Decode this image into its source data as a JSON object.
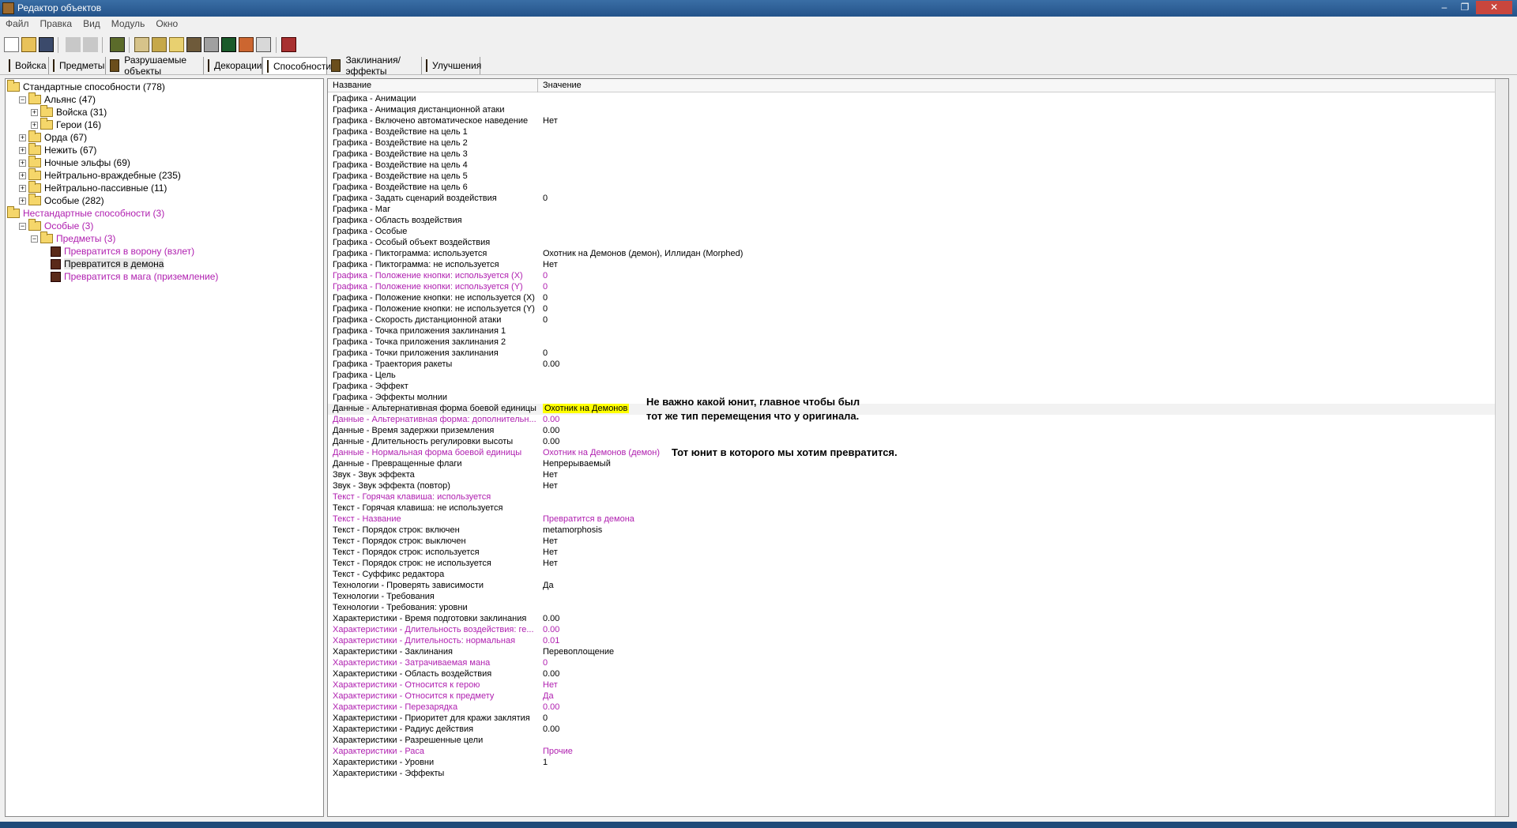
{
  "window": {
    "title": "Редактор объектов",
    "minimize": "–",
    "restore": "❐",
    "close": "✕"
  },
  "menu": [
    "Файл",
    "Правка",
    "Вид",
    "Модуль",
    "Окно"
  ],
  "tabs": [
    {
      "label": "Войска"
    },
    {
      "label": "Предметы"
    },
    {
      "label": "Разрушаемые объекты"
    },
    {
      "label": "Декорации"
    },
    {
      "label": "Способности",
      "active": true
    },
    {
      "label": "Заклинания/эффекты"
    },
    {
      "label": "Улучшения"
    }
  ],
  "tree": [
    {
      "label": "Стандартные способности (778)",
      "level": 0,
      "type": "folder",
      "expander": ""
    },
    {
      "label": "Альянс (47)",
      "level": 1,
      "type": "folder",
      "expander": "−"
    },
    {
      "label": "Войска (31)",
      "level": 2,
      "type": "folder",
      "expander": "+"
    },
    {
      "label": "Герои (16)",
      "level": 2,
      "type": "folder",
      "expander": "+"
    },
    {
      "label": "Орда (67)",
      "level": 1,
      "type": "folder",
      "expander": "+"
    },
    {
      "label": "Нежить (67)",
      "level": 1,
      "type": "folder",
      "expander": "+"
    },
    {
      "label": "Ночные эльфы (69)",
      "level": 1,
      "type": "folder",
      "expander": "+"
    },
    {
      "label": "Нейтрально-враждебные (235)",
      "level": 1,
      "type": "folder",
      "expander": "+"
    },
    {
      "label": "Нейтрально-пассивные (11)",
      "level": 1,
      "type": "folder",
      "expander": "+"
    },
    {
      "label": "Особые (282)",
      "level": 1,
      "type": "folder",
      "expander": "+"
    },
    {
      "label": "Нестандартные способности (3)",
      "level": 0,
      "type": "folder",
      "expander": "",
      "mod": true
    },
    {
      "label": "Особые (3)",
      "level": 1,
      "type": "folder",
      "expander": "−",
      "mod": true
    },
    {
      "label": "Предметы (3)",
      "level": 2,
      "type": "folder",
      "expander": "−",
      "mod": true
    },
    {
      "label": "Превратится в ворону (взлет)",
      "level": 3,
      "type": "ability",
      "mod": true
    },
    {
      "label": "Превратится в демона",
      "level": 3,
      "type": "ability",
      "selected": true
    },
    {
      "label": "Превратится в мага (приземление)",
      "level": 3,
      "type": "ability",
      "mod": true
    }
  ],
  "table": {
    "col_name": "Название",
    "col_value": "Значение",
    "rows": [
      {
        "name": "Графика - Анимации",
        "value": ""
      },
      {
        "name": "Графика - Анимация дистанционной атаки",
        "value": ""
      },
      {
        "name": "Графика - Включено автоматическое наведение",
        "value": "Нет"
      },
      {
        "name": "Графика - Воздействие на цель 1",
        "value": ""
      },
      {
        "name": "Графика - Воздействие на цель 2",
        "value": ""
      },
      {
        "name": "Графика - Воздействие на цель 3",
        "value": ""
      },
      {
        "name": "Графика - Воздействие на цель 4",
        "value": ""
      },
      {
        "name": "Графика - Воздействие на цель 5",
        "value": ""
      },
      {
        "name": "Графика - Воздействие на цель 6",
        "value": ""
      },
      {
        "name": "Графика - Задать сценарий воздействия",
        "value": "0"
      },
      {
        "name": "Графика - Маг",
        "value": ""
      },
      {
        "name": "Графика - Область воздействия",
        "value": ""
      },
      {
        "name": "Графика - Особые",
        "value": ""
      },
      {
        "name": "Графика - Особый объект воздействия",
        "value": ""
      },
      {
        "name": "Графика - Пиктограмма: используется",
        "value": "Охотник на Демонов  (демон), Иллидан (Morphed)"
      },
      {
        "name": "Графика - Пиктограмма: не используется",
        "value": "Нет"
      },
      {
        "name": "Графика - Положение кнопки: используется (X)",
        "value": "0",
        "mod": true
      },
      {
        "name": "Графика - Положение кнопки: используется (Y)",
        "value": "0",
        "mod": true
      },
      {
        "name": "Графика - Положение кнопки: не используется (X)",
        "value": "0"
      },
      {
        "name": "Графика - Положение кнопки: не используется (Y)",
        "value": "0"
      },
      {
        "name": "Графика - Скорость дистанционной атаки",
        "value": "0"
      },
      {
        "name": "Графика - Точка приложения заклинания 1",
        "value": ""
      },
      {
        "name": "Графика - Точка приложения заклинания 2",
        "value": ""
      },
      {
        "name": "Графика - Точки приложения заклинания",
        "value": "0"
      },
      {
        "name": "Графика - Траектория ракеты",
        "value": "0.00"
      },
      {
        "name": "Графика - Цель",
        "value": ""
      },
      {
        "name": "Графика - Эффект",
        "value": ""
      },
      {
        "name": "Графика - Эффекты молнии",
        "value": ""
      },
      {
        "name": "Данные - Альтернативная форма боевой единицы",
        "value": "Охотник на Демонов",
        "highlight": true
      },
      {
        "name": "Данные - Альтернативная форма: дополнительн...",
        "value": "0.00",
        "mod": true
      },
      {
        "name": "Данные - Время задержки приземления",
        "value": "0.00"
      },
      {
        "name": "Данные - Длительность регулировки высоты",
        "value": "0.00"
      },
      {
        "name": "Данные - Нормальная форма боевой единицы",
        "value": "Охотник на Демонов  (демон)",
        "mod": true
      },
      {
        "name": "Данные - Превращенные флаги",
        "value": "Непрерываемый"
      },
      {
        "name": "Звук - Звук эффекта",
        "value": "Нет"
      },
      {
        "name": "Звук - Звук эффекта (повтор)",
        "value": "Нет"
      },
      {
        "name": "Текст - Горячая клавиша: используется",
        "value": "",
        "mod": true
      },
      {
        "name": "Текст - Горячая клавиша: не используется",
        "value": ""
      },
      {
        "name": "Текст - Название",
        "value": "Превратится в демона",
        "mod": true
      },
      {
        "name": "Текст - Порядок строк: включен",
        "value": "metamorphosis"
      },
      {
        "name": "Текст - Порядок строк: выключен",
        "value": "Нет"
      },
      {
        "name": "Текст - Порядок строк: используется",
        "value": "Нет"
      },
      {
        "name": "Текст - Порядок строк: не используется",
        "value": "Нет"
      },
      {
        "name": "Текст - Суффикс редактора",
        "value": ""
      },
      {
        "name": "Технологии - Проверять зависимости",
        "value": "Да"
      },
      {
        "name": "Технологии - Требования",
        "value": ""
      },
      {
        "name": "Технологии - Требования: уровни",
        "value": ""
      },
      {
        "name": "Характеристики - Время подготовки заклинания",
        "value": "0.00"
      },
      {
        "name": "Характеристики - Длительность воздействия: ге...",
        "value": "0.00",
        "mod": true
      },
      {
        "name": "Характеристики - Длительность: нормальная",
        "value": "0.01",
        "mod": true
      },
      {
        "name": "Характеристики - Заклинания",
        "value": "Перевоплощение"
      },
      {
        "name": "Характеристики - Затрачиваемая мана",
        "value": "0",
        "mod": true
      },
      {
        "name": "Характеристики - Область воздействия",
        "value": "0.00"
      },
      {
        "name": "Характеристики - Относится к герою",
        "value": "Нет",
        "mod": true
      },
      {
        "name": "Характеристики - Относится к предмету",
        "value": "Да",
        "mod": true
      },
      {
        "name": "Характеристики - Перезарядка",
        "value": "0.00",
        "mod": true
      },
      {
        "name": "Характеристики - Приоритет для кражи заклятия",
        "value": "0"
      },
      {
        "name": "Характеристики - Радиус действия",
        "value": "0.00"
      },
      {
        "name": "Характеристики - Разрешенные цели",
        "value": ""
      },
      {
        "name": "Характеристики - Раса",
        "value": "Прочие",
        "mod": true
      },
      {
        "name": "Характеристики - Уровни",
        "value": "1"
      },
      {
        "name": "Характеристики - Эффекты",
        "value": ""
      }
    ]
  },
  "annotations": {
    "note1_line1": "Не важно какой юнит, главное чтобы был",
    "note1_line2": "тот же тип перемещения что у оригинала.",
    "note2": "Тот юнит в которого мы хотим превратится."
  },
  "colors": {
    "modified": "#b020b0",
    "highlight": "#ffff00",
    "title_bar": "#2a5d93"
  }
}
